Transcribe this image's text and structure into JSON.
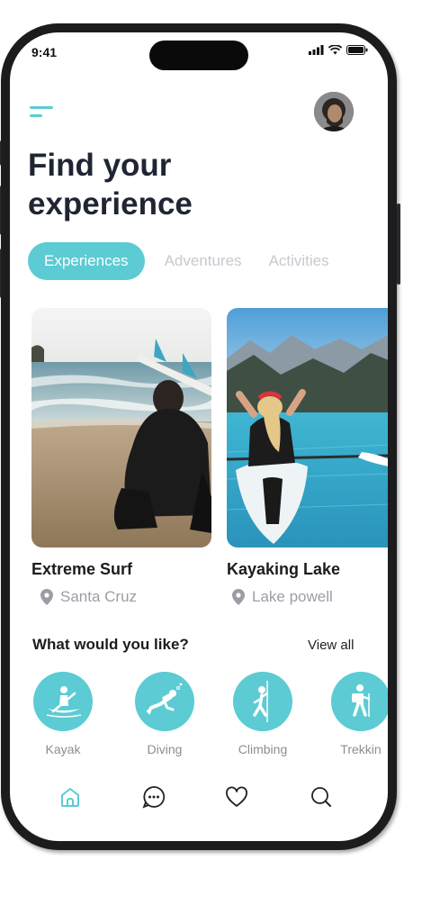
{
  "status": {
    "time": "9:41"
  },
  "header": {
    "menu_icon": "menu-icon",
    "avatar": "user-avatar"
  },
  "title": {
    "line1": "Find your",
    "line2": "experience"
  },
  "tabs": [
    {
      "label": "Experiences",
      "active": true
    },
    {
      "label": "Adventures",
      "active": false
    },
    {
      "label": "Activities",
      "active": false
    }
  ],
  "cards": [
    {
      "title": "Extreme Surf",
      "location": "Santa Cruz"
    },
    {
      "title": "Kayaking Lake",
      "location": "Lake powell"
    }
  ],
  "categories_section": {
    "title": "What would you like?",
    "view_all": "View all"
  },
  "categories": [
    {
      "label": "Kayak",
      "icon": "kayak-icon"
    },
    {
      "label": "Diving",
      "icon": "diving-icon"
    },
    {
      "label": "Climbing",
      "icon": "climbing-icon"
    },
    {
      "label": "Trekkin",
      "icon": "trekking-icon"
    }
  ],
  "bottom_nav": [
    {
      "icon": "home-icon",
      "active": true
    },
    {
      "icon": "chat-icon",
      "active": false
    },
    {
      "icon": "heart-icon",
      "active": false
    },
    {
      "icon": "search-icon",
      "active": false
    }
  ],
  "colors": {
    "accent": "#5ccbd3",
    "title": "#1f2533",
    "muted": "#9a9ea4"
  }
}
